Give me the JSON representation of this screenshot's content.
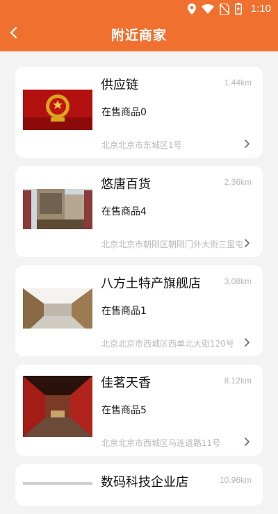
{
  "status": {
    "time": "1:10"
  },
  "header": {
    "title": "附近商家"
  },
  "stores": [
    {
      "name": "供应链",
      "distance": "1.44km",
      "products": "在售商品0",
      "address": "北京北京市东城区1号"
    },
    {
      "name": "悠唐百货",
      "distance": "2.36km",
      "products": "在售商品4",
      "address": "北京北京市朝阳区朝阳门外大街三里屯"
    },
    {
      "name": "八方土特产旗舰店",
      "distance": "3.08km",
      "products": "在售商品1",
      "address": "北京北京市西城区西单北大街120号"
    },
    {
      "name": "佳茗天香",
      "distance": "8.12km",
      "products": "在售商品5",
      "address": "北京北京市西城区马连道路11号"
    },
    {
      "name": "数码科技企业店",
      "distance": "10.96km"
    }
  ],
  "colors": {
    "accent": "#f0712f"
  }
}
